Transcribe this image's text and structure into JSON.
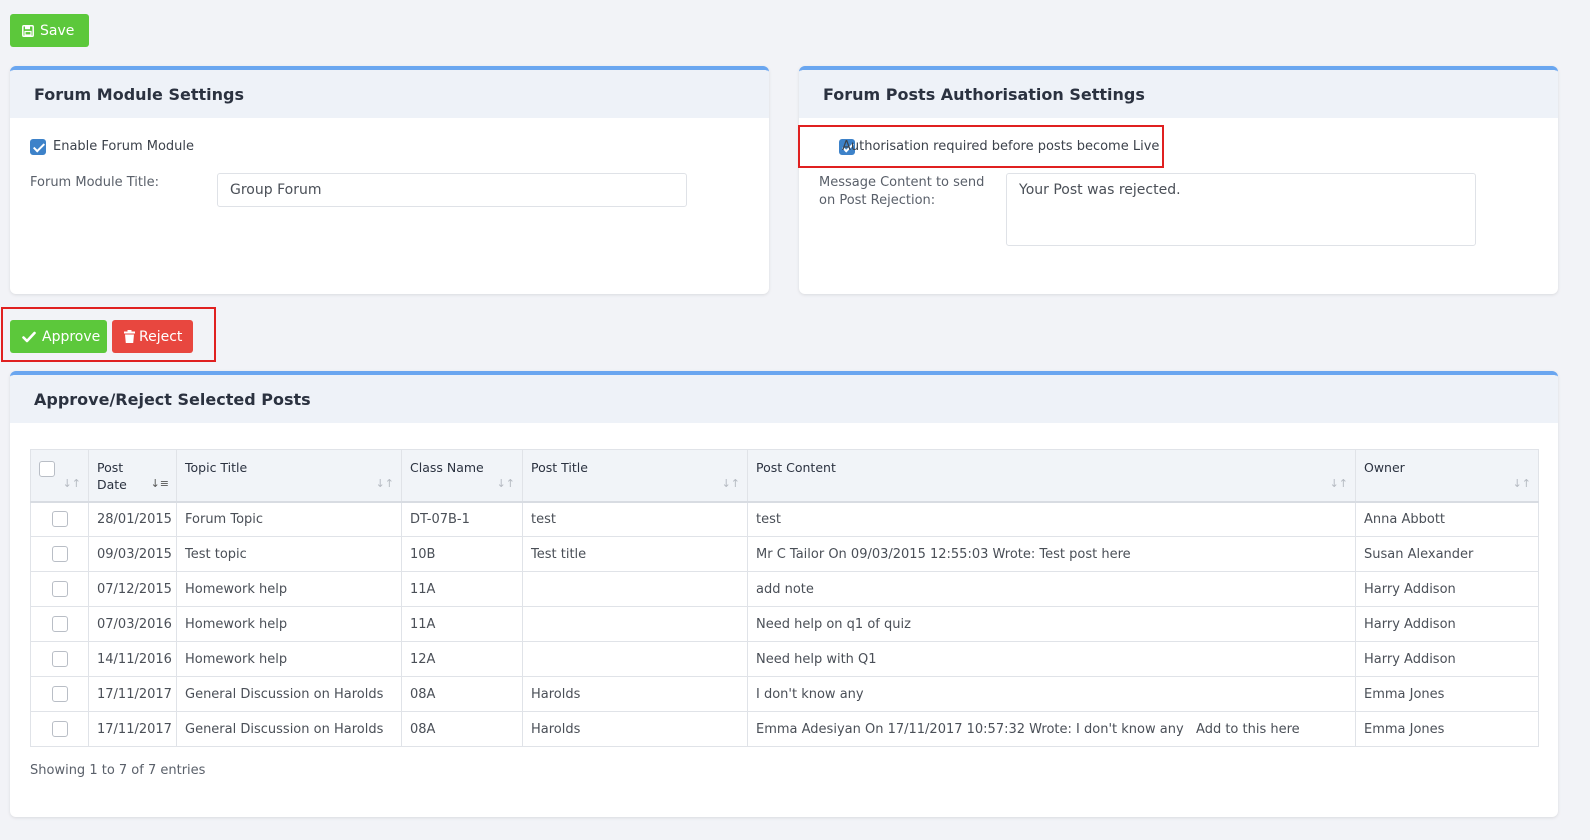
{
  "toolbar": {
    "save_label": "Save"
  },
  "module_settings": {
    "title": "Forum Module Settings",
    "enable_label": "Enable Forum Module",
    "enable_checked": true,
    "title_field_label": "Forum Module Title:",
    "title_field_value": "Group Forum"
  },
  "auth_settings": {
    "title": "Forum Posts Authorisation Settings",
    "auth_label": "Authorisation required before posts become Live",
    "auth_checked": true,
    "rejection_label_line1": "Message Content to send",
    "rejection_label_line2": "on Post Rejection:",
    "rejection_message": "Your Post was rejected."
  },
  "actions": {
    "approve_label": "Approve",
    "reject_label": "Reject"
  },
  "posts_panel": {
    "title": "Approve/Reject Selected Posts",
    "columns": [
      "Post Date",
      "Topic Title",
      "Class Name",
      "Post Title",
      "Post Content",
      "Owner"
    ],
    "rows": [
      {
        "date": "28/01/2015",
        "topic": "Forum Topic",
        "class": "DT-07B-1",
        "post_title": "test",
        "content": "test",
        "owner": "Anna Abbott"
      },
      {
        "date": "09/03/2015",
        "topic": "Test topic",
        "class": "10B",
        "post_title": "Test title",
        "content": "Mr C Tailor On 09/03/2015 12:55:03 Wrote: Test post here",
        "owner": "Susan Alexander"
      },
      {
        "date": "07/12/2015",
        "topic": "Homework help",
        "class": "11A",
        "post_title": "",
        "content": "add note",
        "owner": "Harry Addison"
      },
      {
        "date": "07/03/2016",
        "topic": "Homework help",
        "class": "11A",
        "post_title": "",
        "content": "Need help on q1 of quiz",
        "owner": "Harry Addison"
      },
      {
        "date": "14/11/2016",
        "topic": "Homework help",
        "class": "12A",
        "post_title": "",
        "content": "Need help with Q1",
        "owner": "Harry Addison"
      },
      {
        "date": "17/11/2017",
        "topic": "General Discussion on Harolds",
        "class": "08A",
        "post_title": "Harolds",
        "content": "I don't know any",
        "owner": "Emma Jones"
      },
      {
        "date": "17/11/2017",
        "topic": "General Discussion on Harolds",
        "class": "08A",
        "post_title": "Harolds",
        "content": "Emma Adesiyan On 17/11/2017 10:57:32 Wrote: I don't know any   Add to this here",
        "owner": "Emma Jones"
      }
    ],
    "footer": "Showing 1 to 7 of 7 entries"
  },
  "colors": {
    "green": "#5cc83b",
    "red": "#e8473f",
    "accent": "#6aa6f0",
    "checkbox": "#3d82c9"
  }
}
